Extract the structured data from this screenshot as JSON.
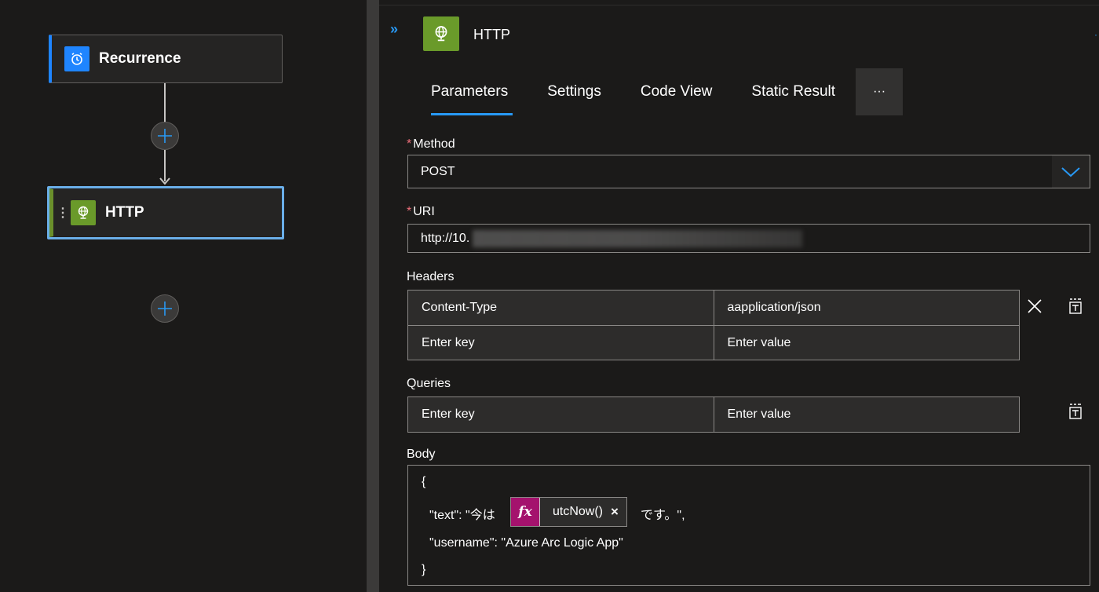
{
  "canvas": {
    "nodes": [
      {
        "label": "Recurrence",
        "icon": "alarm-clock-icon",
        "accent": "#1f85ff"
      },
      {
        "label": "HTTP",
        "icon": "globe-icon",
        "accent": "#6a9a2a"
      }
    ]
  },
  "panel": {
    "collapse_glyph": "»",
    "title": "HTTP",
    "tabs": [
      {
        "label": "Parameters",
        "active": true
      },
      {
        "label": "Settings",
        "active": false
      },
      {
        "label": "Code View",
        "active": false
      },
      {
        "label": "Static Result",
        "active": false
      }
    ],
    "more_label": "···",
    "method": {
      "label": "Method",
      "required": "*",
      "value": "POST"
    },
    "uri": {
      "label": "URI",
      "required": "*",
      "value": "http://10."
    },
    "headers": {
      "label": "Headers",
      "rows": [
        {
          "key": "Content-Type",
          "value": "aapplication/json"
        },
        {
          "key": "Enter key",
          "value": "Enter value"
        }
      ]
    },
    "queries": {
      "label": "Queries",
      "rows": [
        {
          "key": "Enter key",
          "value": "Enter value"
        }
      ]
    },
    "body": {
      "label": "Body",
      "open_brace": "{",
      "text_prefix": "\"text\": \"今は",
      "token_fx": "fx",
      "token_name": "utcNow()",
      "token_remove": "×",
      "text_suffix": "です。\",",
      "username_line": "\"username\": \"Azure Arc Logic App\"",
      "close_brace": "}"
    }
  },
  "colors": {
    "accent_blue": "#2899f5",
    "http_green": "#6a9a2a",
    "token_magenta": "#a4126d",
    "required_red": "#f1707b"
  }
}
